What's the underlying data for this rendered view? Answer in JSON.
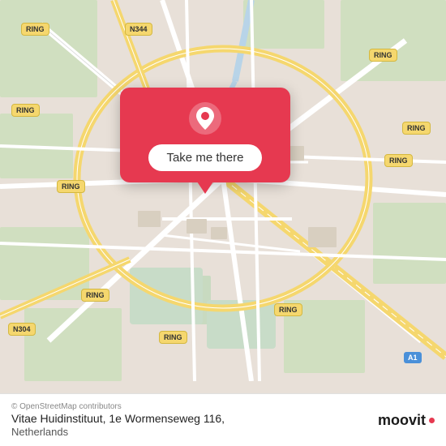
{
  "map": {
    "attribution": "© OpenStreetMap contributors",
    "popup": {
      "button_label": "Take me there"
    },
    "address": {
      "line1": "Vitae Huidinstituut, 1e Wormenseweg 116,",
      "line2": "Netherlands"
    },
    "labels": {
      "ring_top_left1": "RING",
      "ring_top_left2": "RING",
      "ring_top_right1": "RING",
      "ring_top_right2": "RING",
      "ring_mid_left": "RING",
      "ring_mid_right": "RING",
      "ring_bot_left1": "RING",
      "ring_bot_left2": "RING",
      "ring_bot_right": "RING",
      "road_n344": "N344",
      "road_n304": "N304",
      "road_a1": "A1"
    }
  },
  "branding": {
    "logo_text": "moovit"
  }
}
